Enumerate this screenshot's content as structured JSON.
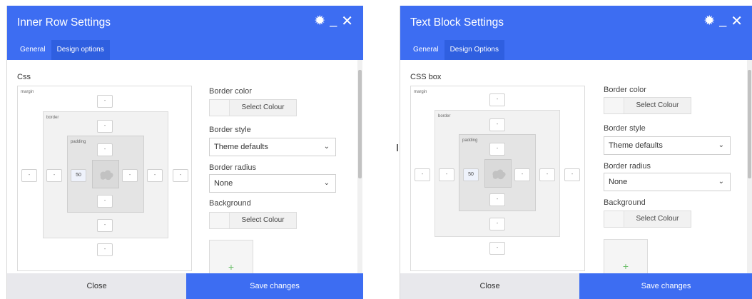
{
  "panels": [
    {
      "title": "Inner Row Settings",
      "tabs": [
        {
          "label": "General"
        },
        {
          "label": "Design options"
        }
      ],
      "active_tab": 1,
      "css_label": "Css",
      "box": {
        "margin_label": "margin",
        "border_label": "border",
        "padding_label": "padding",
        "placeholder": "-",
        "padding_left_value": "50"
      },
      "border_color_label": "Border color",
      "select_colour": "Select Colour",
      "border_style_label": "Border style",
      "border_style_value": "Theme defaults",
      "border_radius_label": "Border radius",
      "border_radius_value": "None",
      "background_label": "Background",
      "background_colour": "Select Colour",
      "add_image_symbol": "+",
      "close_label": "Close",
      "save_label": "Save changes"
    },
    {
      "title": "Text Block Settings",
      "tabs": [
        {
          "label": "General"
        },
        {
          "label": "Design Options"
        }
      ],
      "active_tab": 1,
      "css_label": "CSS box",
      "box": {
        "margin_label": "margin",
        "border_label": "border",
        "padding_label": "padding",
        "placeholder": "-",
        "padding_left_value": "50"
      },
      "border_color_label": "Border color",
      "select_colour": "Select Colour",
      "border_style_label": "Border style",
      "border_style_value": "Theme defaults",
      "border_radius_label": "Border radius",
      "border_radius_value": "None",
      "background_label": "Background",
      "background_colour": "Select Colour",
      "add_image_symbol": "+",
      "close_label": "Close",
      "save_label": "Save changes"
    }
  ],
  "colors": {
    "accent": "#3d6df2",
    "active_tab": "#2f5fe0",
    "footer_close_bg": "#e8e8ec",
    "add_plus": "#6cbf6a"
  },
  "icons": {
    "settings": "gear-icon",
    "minimize": "minimize-icon",
    "close": "close-icon",
    "dropdown": "chevron-down-icon",
    "add_image": "plus-icon"
  }
}
